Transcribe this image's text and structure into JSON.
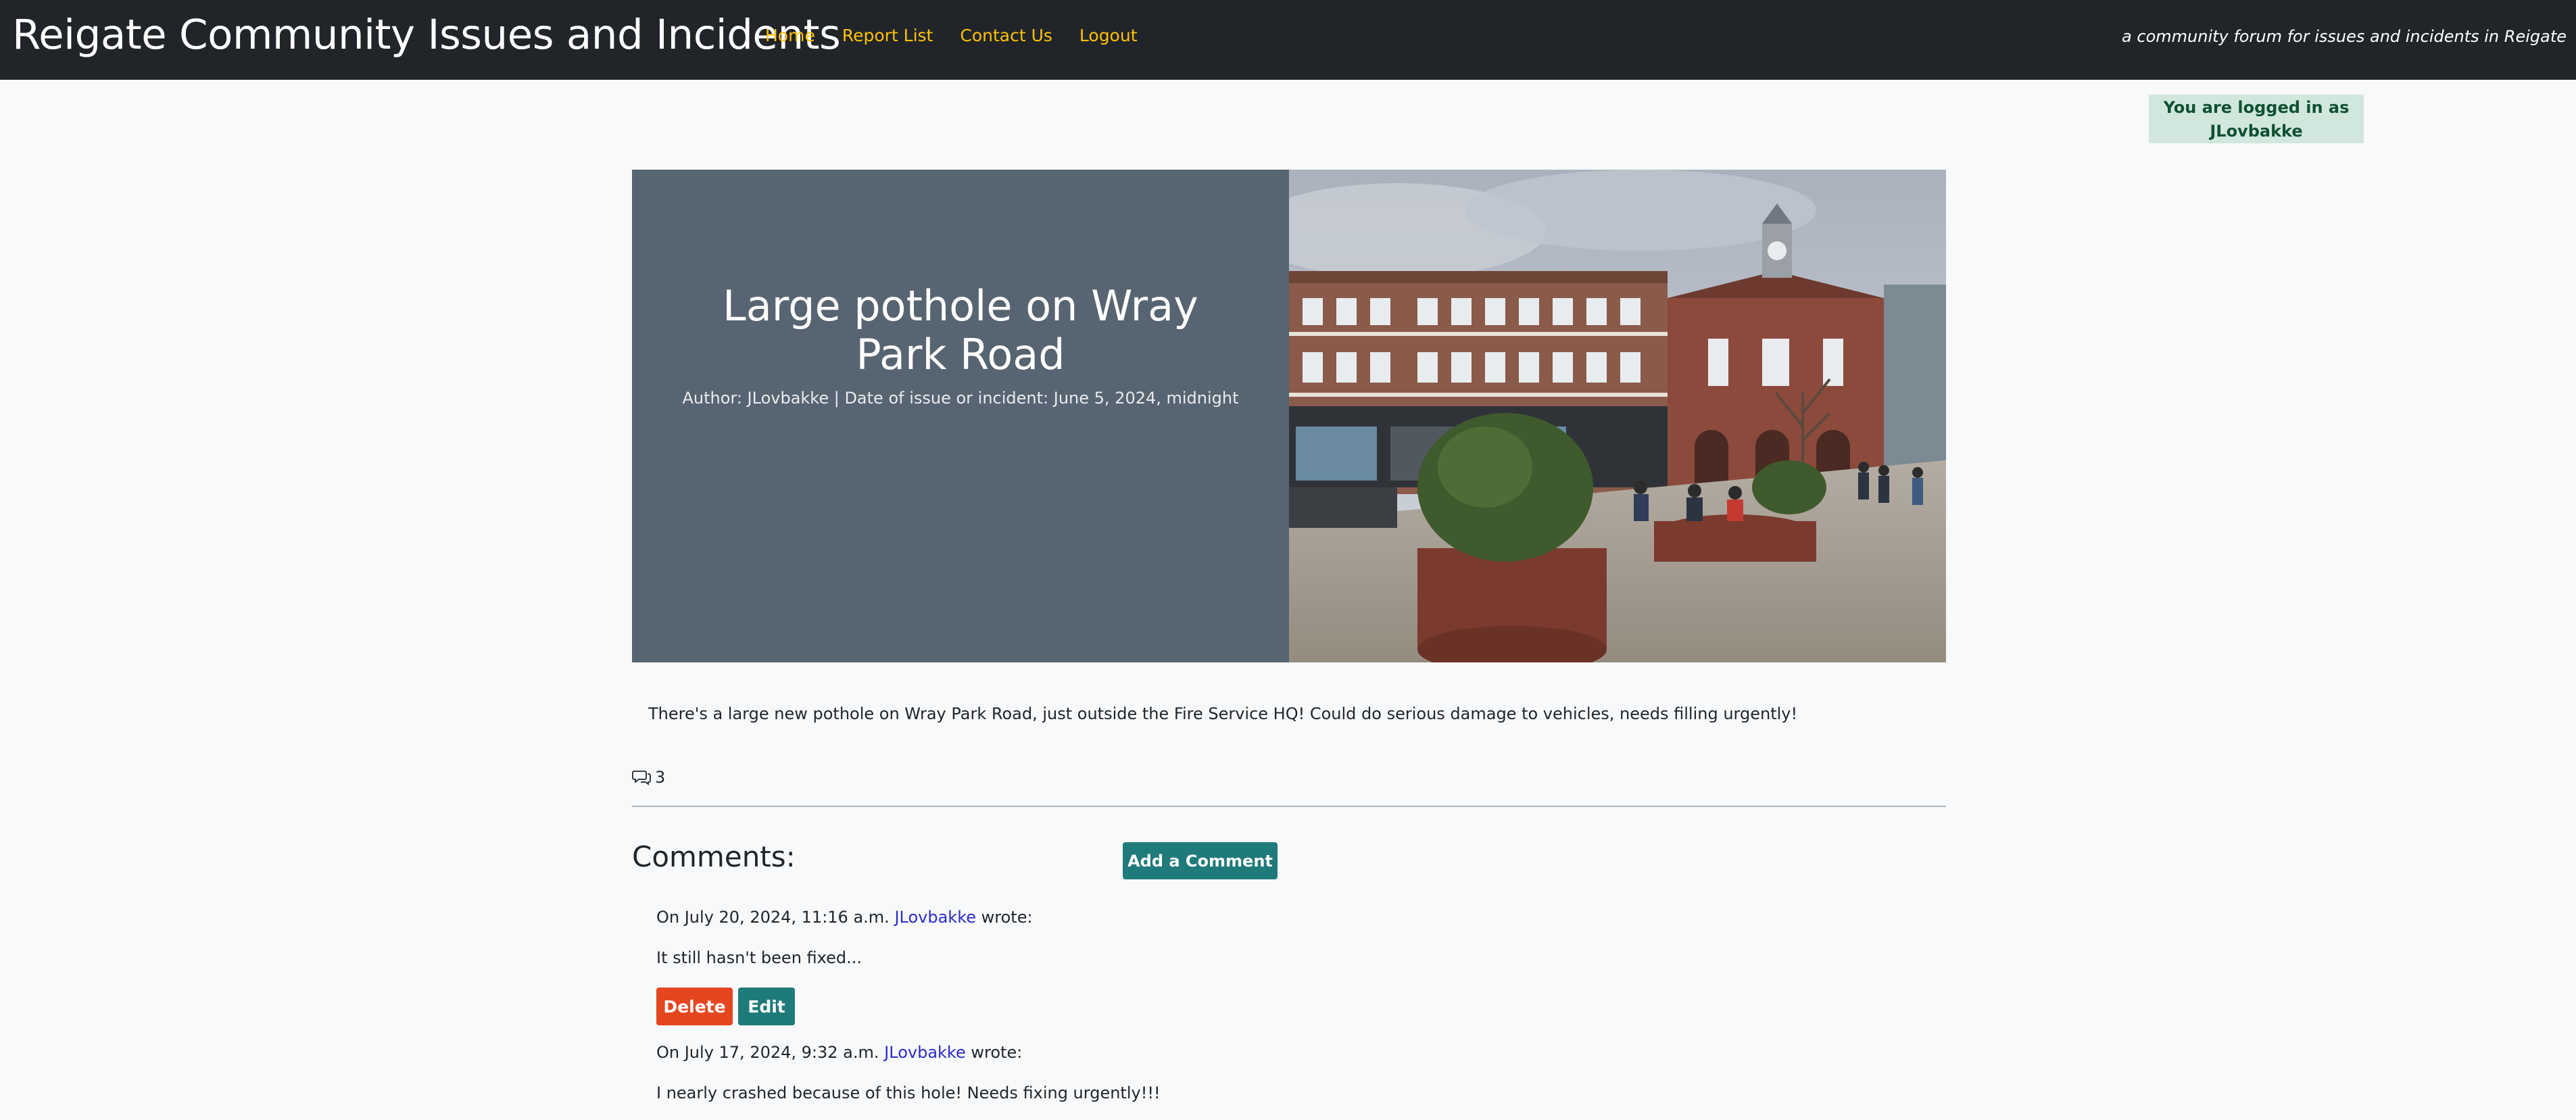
{
  "navbar": {
    "brand": "Reigate Community Issues and Incidents",
    "links": [
      "Home",
      "Report List",
      "Contact Us",
      "Logout"
    ],
    "tagline": "a community forum for issues and incidents in Reigate"
  },
  "login_status": "You are logged in as JLovbakke",
  "issue": {
    "title": "Large pothole on Wray Park Road",
    "meta": "Author: JLovbakke | Date of issue or incident: June 5, 2024, midnight",
    "body": "There's a large new pothole on Wray Park Road, just outside the Fire Service HQ! Could do serious damage to vehicles, needs filling urgently!",
    "comment_count": "3"
  },
  "comments_section": {
    "heading": "Comments:",
    "add_button": "Add a Comment",
    "delete_label": "Delete",
    "edit_label": "Edit",
    "items": [
      {
        "prefix": "On July 20, 2024, 11:16 a.m.",
        "author": "JLovbakke",
        "suffix": "wrote:",
        "text": "It still hasn't been fixed..."
      },
      {
        "prefix": "On July 17, 2024, 9:32 a.m.",
        "author": "JLovbakke",
        "suffix": "wrote:",
        "text": "I nearly crashed because of this hole! Needs fixing urgently!!!"
      }
    ]
  },
  "colors": {
    "navbar_bg": "#212529",
    "nav_link": "#ffc107",
    "hero_bg": "#576471",
    "teal_button": "#1f7a7a",
    "delete_button": "#e4471f",
    "login_badge_bg": "#d1e7dd"
  }
}
